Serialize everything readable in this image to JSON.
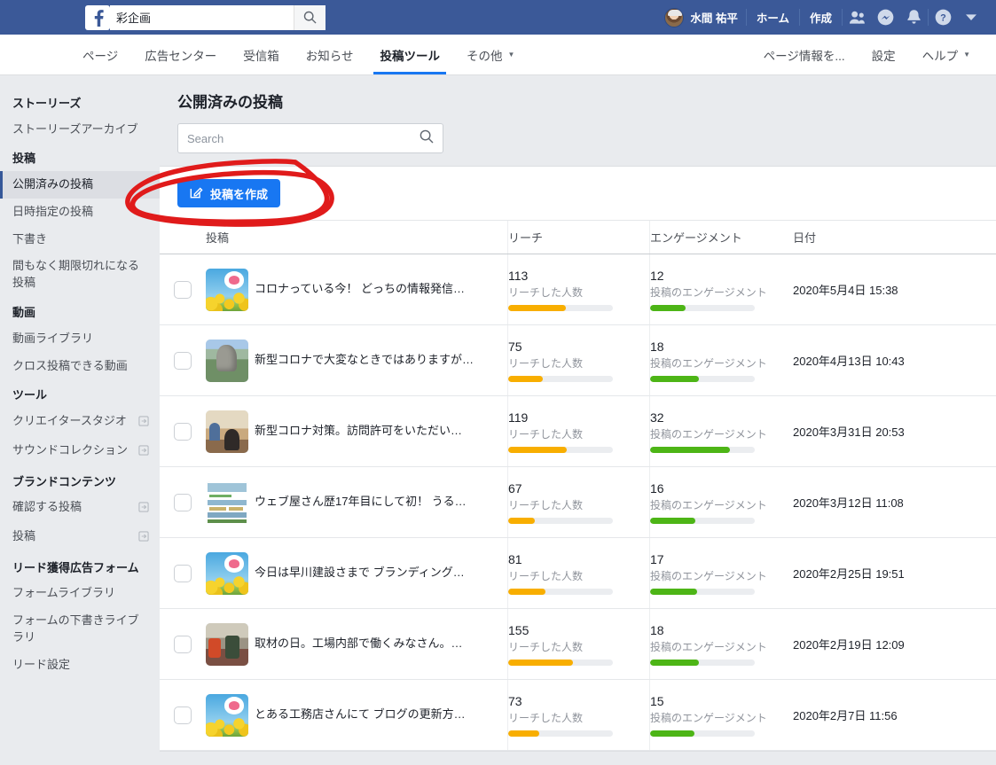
{
  "topbar": {
    "logo_icon": "facebook-logo-icon",
    "search_value": "彩企画",
    "search_placeholder": "",
    "search_icon": "search-icon",
    "user_name": "水間 祐平",
    "home_label": "ホーム",
    "create_label": "作成",
    "icons": [
      {
        "name": "friend-requests-icon"
      },
      {
        "name": "messenger-icon"
      },
      {
        "name": "notifications-bell-icon"
      },
      {
        "name": "help-icon"
      },
      {
        "name": "account-dropdown-icon"
      }
    ]
  },
  "subnav": {
    "left_items": [
      {
        "label": "ページ",
        "active": false
      },
      {
        "label": "広告センター",
        "active": false
      },
      {
        "label": "受信箱",
        "active": false
      },
      {
        "label": "お知らせ",
        "active": false
      },
      {
        "label": "投稿ツール",
        "active": true
      },
      {
        "label": "その他",
        "active": false,
        "caret": true
      }
    ],
    "right_items": [
      {
        "label": "ページ情報を...",
        "caret": false
      },
      {
        "label": "設定",
        "caret": false
      },
      {
        "label": "ヘルプ",
        "caret": true
      }
    ]
  },
  "sidebar": {
    "groups": [
      {
        "title": "ストーリーズ",
        "items": [
          {
            "label": "ストーリーズアーカイブ",
            "selected": false,
            "external": false
          }
        ]
      },
      {
        "title": "投稿",
        "items": [
          {
            "label": "公開済みの投稿",
            "selected": true,
            "external": false
          },
          {
            "label": "日時指定の投稿",
            "selected": false,
            "external": false
          },
          {
            "label": "下書き",
            "selected": false,
            "external": false
          },
          {
            "label": "間もなく期限切れになる投稿",
            "selected": false,
            "external": false
          }
        ]
      },
      {
        "title": "動画",
        "items": [
          {
            "label": "動画ライブラリ",
            "selected": false,
            "external": false
          },
          {
            "label": "クロス投稿できる動画",
            "selected": false,
            "external": false
          }
        ]
      },
      {
        "title": "ツール",
        "items": [
          {
            "label": "クリエイタースタジオ",
            "selected": false,
            "external": true
          },
          {
            "label": "サウンドコレクション",
            "selected": false,
            "external": true
          }
        ]
      },
      {
        "title": "ブランドコンテンツ",
        "items": [
          {
            "label": "確認する投稿",
            "selected": false,
            "external": true
          },
          {
            "label": "投稿",
            "selected": false,
            "external": true
          }
        ]
      },
      {
        "title": "リード獲得広告フォーム",
        "items": [
          {
            "label": "フォームライブラリ",
            "selected": false,
            "external": false
          },
          {
            "label": "フォームの下書きライブラリ",
            "selected": false,
            "external": false
          },
          {
            "label": "リード設定",
            "selected": false,
            "external": false
          }
        ]
      }
    ]
  },
  "main": {
    "title": "公開済みの投稿",
    "search_placeholder": "Search",
    "search_value": "",
    "search_icon": "search-icon",
    "create_button_label": "投稿を作成",
    "create_button_icon": "compose-pencil-icon",
    "table": {
      "headers": {
        "post": "投稿",
        "reach": "リーチ",
        "engagement": "エンゲージメント",
        "date": "日付"
      },
      "reach_sublabel": "リーチした人数",
      "engagement_sublabel": "投稿のエンゲージメント",
      "rows": [
        {
          "title": "コロナっている今！ どっちの情報発信…",
          "thumb": "flowers",
          "reach": "113",
          "reach_pct": 55,
          "engagement": "12",
          "engagement_pct": 34,
          "date": "2020年5月4日 15:38"
        },
        {
          "title": "新型コロナで大変なときではありますが…",
          "thumb": "mountain",
          "reach": "75",
          "reach_pct": 33,
          "engagement": "18",
          "engagement_pct": 47,
          "date": "2020年4月13日 10:43"
        },
        {
          "title": "新型コロナ対策。訪問許可をいただい…",
          "thumb": "room",
          "reach": "119",
          "reach_pct": 56,
          "engagement": "32",
          "engagement_pct": 76,
          "date": "2020年3月31日 20:53"
        },
        {
          "title": "ウェブ屋さん歴17年目にして初！ うる…",
          "thumb": "screen",
          "reach": "67",
          "reach_pct": 25,
          "engagement": "16",
          "engagement_pct": 43,
          "date": "2020年3月12日 11:08"
        },
        {
          "title": "今日は早川建設さまで ブランディング…",
          "thumb": "flowers",
          "reach": "81",
          "reach_pct": 36,
          "engagement": "17",
          "engagement_pct": 45,
          "date": "2020年2月25日 19:51"
        },
        {
          "title": "取材の日。工場内部で働くみなさん。…",
          "thumb": "factory",
          "reach": "155",
          "reach_pct": 62,
          "engagement": "18",
          "engagement_pct": 47,
          "date": "2020年2月19日 12:09"
        },
        {
          "title": "とある工務店さんにて ブログの更新方…",
          "thumb": "flowers",
          "reach": "73",
          "reach_pct": 30,
          "engagement": "15",
          "engagement_pct": 42,
          "date": "2020年2月7日 11:56"
        }
      ]
    }
  },
  "annotation": {
    "name": "red-circle-annotation",
    "color": "#e01b1b",
    "target": "投稿を作成"
  },
  "colors": {
    "header_blue": "#3b5998",
    "accent_blue": "#1877f2",
    "reach_bar": "#f8ae00",
    "engagement_bar": "#4db516",
    "bar_track": "#ebedf0"
  }
}
